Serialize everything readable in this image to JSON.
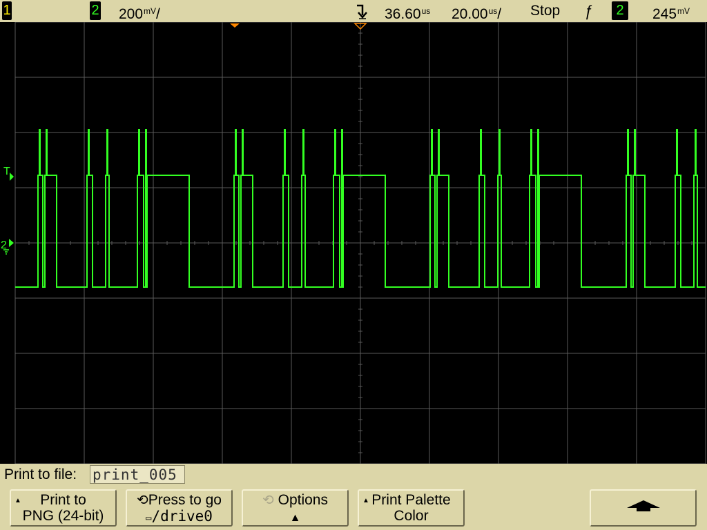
{
  "status_bar": {
    "channel1_label": "1",
    "channel2_label": "2",
    "channel2_scale": "200",
    "channel2_scale_unit": "mV",
    "channel2_scale_suffix": "/",
    "trigger_icon": "trigger-marker-icon",
    "time_delay": "36.60",
    "time_delay_unit": "us",
    "time_scale": "20.00",
    "time_scale_unit": "us",
    "time_scale_suffix": "/",
    "run_state": "Stop",
    "trigger_slope": "ƒ",
    "trigger_source": "2",
    "trigger_level": "245",
    "trigger_level_unit": "mV"
  },
  "markers": {
    "trigger_level": "T",
    "channel2_ground": "2"
  },
  "print": {
    "label": "Print to file:",
    "filename": "print_005"
  },
  "softkeys": [
    {
      "line1": "Print to",
      "line2": "PNG (24-bit)"
    },
    {
      "line1": "Press to go",
      "line2": "/drive0"
    },
    {
      "line1": "Options",
      "line2": ""
    },
    {
      "line1": "Print Palette",
      "line2": "Color"
    },
    {
      "line1": "",
      "line2": ""
    }
  ],
  "colors": {
    "background": "#000000",
    "graticule": "#5a5a5a",
    "channel1": "#ffee00",
    "channel2": "#33ff22",
    "chrome": "#dcd6a8",
    "trigger_marker": "#ff8800"
  },
  "waveform": {
    "channel": "2",
    "high_v": 0.245,
    "low_v": -0.16,
    "glitch_v": 0.41
  }
}
